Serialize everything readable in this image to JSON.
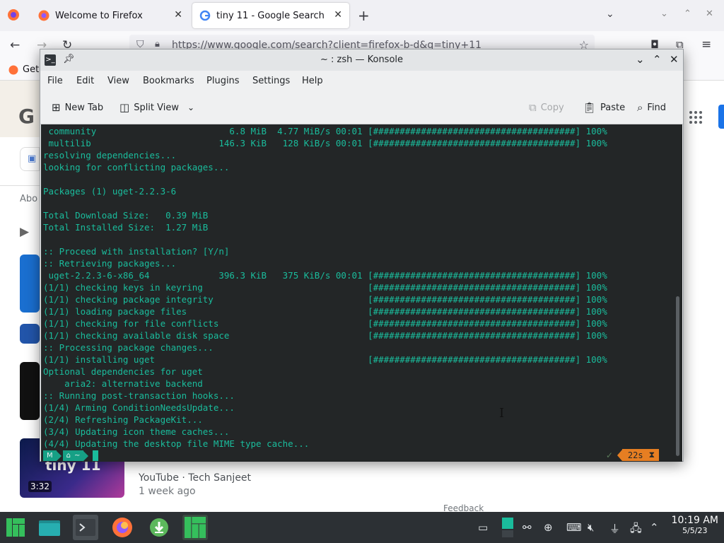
{
  "firefox": {
    "tabs": [
      {
        "title": "Welcome to Firefox"
      },
      {
        "title": "tiny 11 - Google Search"
      }
    ],
    "new_tab_symbol": "+",
    "url": "https://www.google.com/search?client=firefox-b-d&q=tiny+11",
    "bookmark_fragment": "Get",
    "google_fragment": "Abo",
    "video_duration": "3:32",
    "video_source": "YouTube · Tech Sanjeet",
    "video_age": "1 week ago",
    "thumb_text": "tiny 11",
    "feedback": "Feedback"
  },
  "konsole": {
    "title": "~ : zsh — Konsole",
    "menu": [
      "File",
      "Edit",
      "View",
      "Bookmarks",
      "Plugins",
      "Settings",
      "Help"
    ],
    "toolbar": {
      "new_tab": "New Tab",
      "split_view": "Split View",
      "copy": "Copy",
      "paste": "Paste",
      "find": "Find"
    },
    "terminal_lines": [
      " community                         6.8 MiB  4.77 MiB/s 00:01 [######################################] 100%",
      " multilib                        146.3 KiB   128 KiB/s 00:01 [######################################] 100%",
      "resolving dependencies...",
      "looking for conflicting packages...",
      "",
      "Packages (1) uget-2.2.3-6",
      "",
      "Total Download Size:   0.39 MiB",
      "Total Installed Size:  1.27 MiB",
      "",
      ":: Proceed with installation? [Y/n]",
      ":: Retrieving packages...",
      " uget-2.2.3-6-x86_64             396.3 KiB   375 KiB/s 00:01 [######################################] 100%",
      "(1/1) checking keys in keyring                               [######################################] 100%",
      "(1/1) checking package integrity                             [######################################] 100%",
      "(1/1) loading package files                                  [######################################] 100%",
      "(1/1) checking for file conflicts                            [######################################] 100%",
      "(1/1) checking available disk space                          [######################################] 100%",
      ":: Processing package changes...",
      "(1/1) installing uget                                        [######################################] 100%",
      "Optional dependencies for uget",
      "    aria2: alternative backend",
      ":: Running post-transaction hooks...",
      "(1/4) Arming ConditionNeedsUpdate...",
      "(2/4) Refreshing PackageKit...",
      "(3/4) Updating icon theme caches...",
      "(4/4) Updating the desktop file MIME type cache..."
    ],
    "prompt": {
      "os_glyph": "M",
      "home_glyph": "⌂",
      "dir": "~"
    },
    "rprompt": {
      "status": "✓",
      "elapsed": "22s",
      "hourglass": "⧗"
    }
  },
  "taskbar": {
    "clock_time": "10:19 AM",
    "clock_date": "5/5/23"
  },
  "colors": {
    "terminal_bg": "#232627",
    "terminal_fg": "#1abc9c",
    "prompt_segment": "#16a085",
    "elapsed_segment": "#e67e22",
    "taskbar_bg": "#2c3034",
    "manjaro_green": "#35bf5c"
  }
}
